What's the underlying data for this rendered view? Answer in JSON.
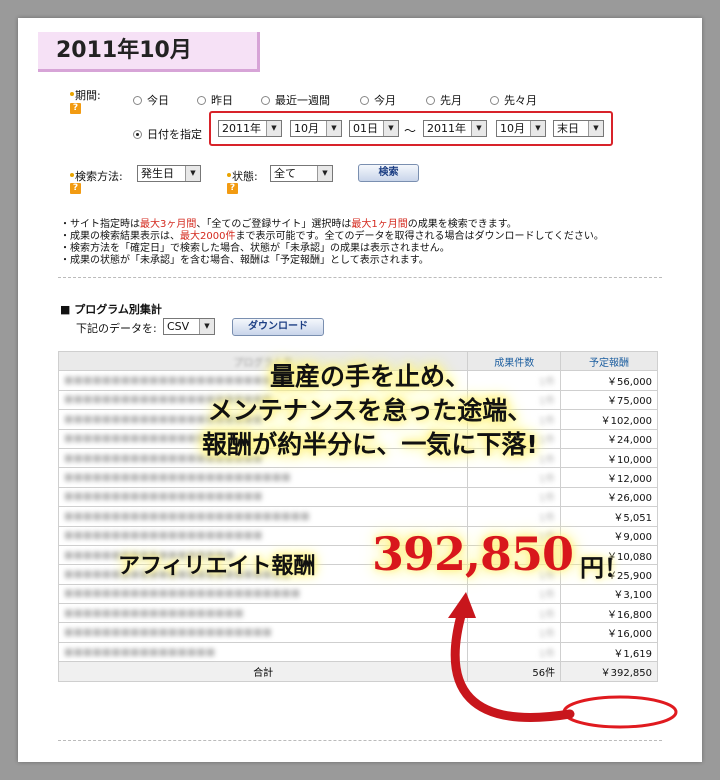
{
  "page": {
    "title": "2011年10月"
  },
  "filter": {
    "period_label": "期間:",
    "help": "?",
    "radios": [
      "今日",
      "昨日",
      "最近一週間",
      "今月",
      "先月",
      "先々月"
    ],
    "date_radio": "日付を指定",
    "date_from": {
      "year": "2011年",
      "month": "10月",
      "day": "01日"
    },
    "tilde": "～",
    "date_to": {
      "year": "2011年",
      "month": "10月",
      "day": "末日"
    },
    "search_method_label": "検索方法:",
    "search_method_value": "発生日",
    "status_label": "状態:",
    "status_value": "全て",
    "search_button": "検索"
  },
  "notes": [
    {
      "a": "・サイト指定時は",
      "r1": "最大3ヶ月間",
      "b": "、「全てのご登録サイト」選択時は",
      "r2": "最大1ヶ月間",
      "c": "の成果を検索できます。"
    },
    {
      "a": "・成果の検索結果表示は、",
      "r1": "最大2000件",
      "b": "まで表示可能です。全てのデータを取得される場合はダウンロードしてください。",
      "r2": "",
      "c": ""
    },
    {
      "a": "・検索方法を「確定日」で検索した場合、状態が「未承認」の成果は表示されません。",
      "r1": "",
      "b": "",
      "r2": "",
      "c": ""
    },
    {
      "a": "・成果の状態が「未承認」を含む場合、報酬は「予定報酬」として表示されます。",
      "r1": "",
      "b": "",
      "r2": "",
      "c": ""
    }
  ],
  "program": {
    "section_title": "■ プログラム別集計",
    "data_label": "下記のデータを:",
    "format_value": "CSV",
    "download_button": "ダウンロード"
  },
  "table": {
    "headers": [
      "プログラム名",
      "成果件数",
      "予定報酬"
    ],
    "rows": [
      {
        "name": "■■■■■■■■■■■■■■■■■■■■■■■",
        "count": "1件",
        "amount": "￥56,000"
      },
      {
        "name": "■■■■■■■■■■■■■■■■■■■■■■",
        "count": "1件",
        "amount": "￥75,000"
      },
      {
        "name": "■■■■■■■■■■■■■■■■■■■■■",
        "count": "1件",
        "amount": "￥102,000"
      },
      {
        "name": "■■■■■■■■■■■■■■■■■■■",
        "count": "1件",
        "amount": "￥24,000"
      },
      {
        "name": "■■■■■■■■■■■■■■■■■■■■■",
        "count": "1件",
        "amount": "￥10,000"
      },
      {
        "name": "■■■■■■■■■■■■■■■■■■■■■■■■",
        "count": "1件",
        "amount": "￥12,000"
      },
      {
        "name": "■■■■■■■■■■■■■■■■■■■■■",
        "count": "1件",
        "amount": "￥26,000"
      },
      {
        "name": "■■■■■■■■■■■■■■■■■■■■■■■■■■",
        "count": "1件",
        "amount": "￥5,051"
      },
      {
        "name": "■■■■■■■■■■■■■■■■■■■■■",
        "count": "1件",
        "amount": "￥9,000"
      },
      {
        "name": "■■■■■■■■■■■■■■■■■■",
        "count": "1件",
        "amount": "￥10,080"
      },
      {
        "name": "■■■■■■■■■■■■■■■■■■■■■■■■",
        "count": "1件",
        "amount": "￥25,900"
      },
      {
        "name": "■■■■■■■■■■■■■■■■■■■■■■■■■",
        "count": "1件",
        "amount": "￥3,100"
      },
      {
        "name": "■■■■■■■■■■■■■■■■■■■",
        "count": "1件",
        "amount": "￥16,800"
      },
      {
        "name": "■■■■■■■■■■■■■■■■■■■■■■",
        "count": "1件",
        "amount": "￥16,000"
      },
      {
        "name": "■■■■■■■■■■■■■■■■",
        "count": "1件",
        "amount": "￥1,619"
      }
    ],
    "total_label": "合計",
    "total_count": "56件",
    "total_amount": "￥392,850"
  },
  "overlay": {
    "line1": "量産の手を止め、",
    "line2": "メンテナンスを怠った途端、",
    "line3": "報酬が約半分に、一気に下落!",
    "affiliate_label": "アフィリエイト報酬",
    "amount": "392,850",
    "unit": "円！"
  },
  "colors": {
    "accent_red": "#d8232a",
    "title_bg": "#f6e1f6",
    "highlight_glow": "#fff48a"
  }
}
